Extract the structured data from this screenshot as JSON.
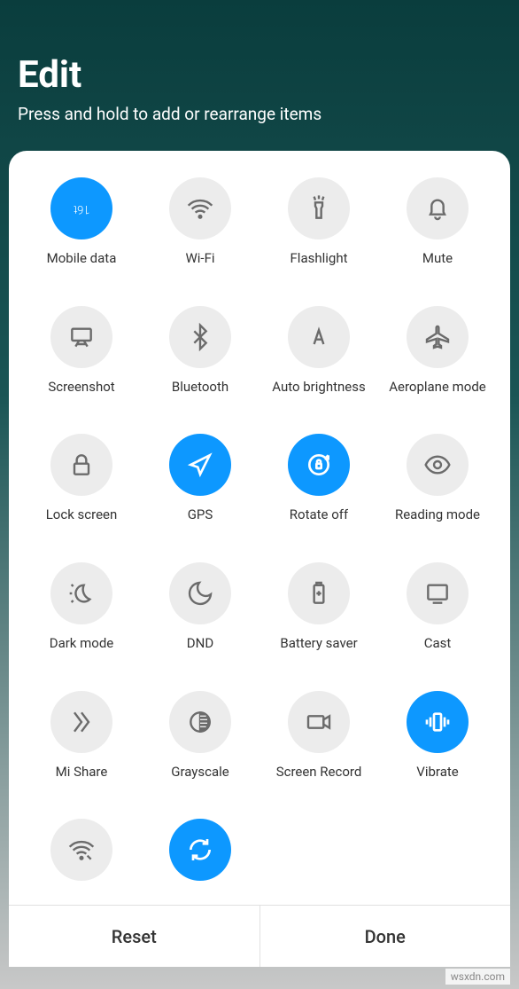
{
  "header": {
    "title": "Edit",
    "subtitle": "Press and hold to add or rearrange items"
  },
  "tiles": [
    {
      "label": "Mobile data",
      "icon": "mobile-data",
      "active": true,
      "badge": "16t"
    },
    {
      "label": "Wi-Fi",
      "icon": "wifi",
      "active": false
    },
    {
      "label": "Flashlight",
      "icon": "flashlight",
      "active": false
    },
    {
      "label": "Mute",
      "icon": "bell",
      "active": false
    },
    {
      "label": "Screenshot",
      "icon": "screenshot",
      "active": false
    },
    {
      "label": "Bluetooth",
      "icon": "bluetooth",
      "active": false
    },
    {
      "label": "Auto brightness",
      "icon": "brightness-auto",
      "active": false
    },
    {
      "label": "Aeroplane mode",
      "icon": "airplane",
      "active": false
    },
    {
      "label": "Lock screen",
      "icon": "lock",
      "active": false
    },
    {
      "label": "GPS",
      "icon": "location",
      "active": true
    },
    {
      "label": "Rotate off",
      "icon": "rotate-lock",
      "active": true
    },
    {
      "label": "Reading mode",
      "icon": "eye",
      "active": false
    },
    {
      "label": "Dark mode",
      "icon": "dark-mode",
      "active": false
    },
    {
      "label": "DND",
      "icon": "moon",
      "active": false
    },
    {
      "label": "Battery saver",
      "icon": "battery",
      "active": false
    },
    {
      "label": "Cast",
      "icon": "cast",
      "active": false
    },
    {
      "label": "Mi Share",
      "icon": "mi-share",
      "active": false
    },
    {
      "label": "Grayscale",
      "icon": "grayscale",
      "active": false
    },
    {
      "label": "Screen Record",
      "icon": "screen-record",
      "active": false
    },
    {
      "label": "Vibrate",
      "icon": "vibrate",
      "active": true
    },
    {
      "label": "",
      "icon": "wifi-edit",
      "active": false
    },
    {
      "label": "",
      "icon": "sync",
      "active": true
    }
  ],
  "footer": {
    "reset": "Reset",
    "done": "Done"
  },
  "watermark": "wsxdn.com",
  "colors": {
    "active": "#0d98ff",
    "inactive": "#ececec",
    "icon_inactive": "#6b6b6b"
  }
}
